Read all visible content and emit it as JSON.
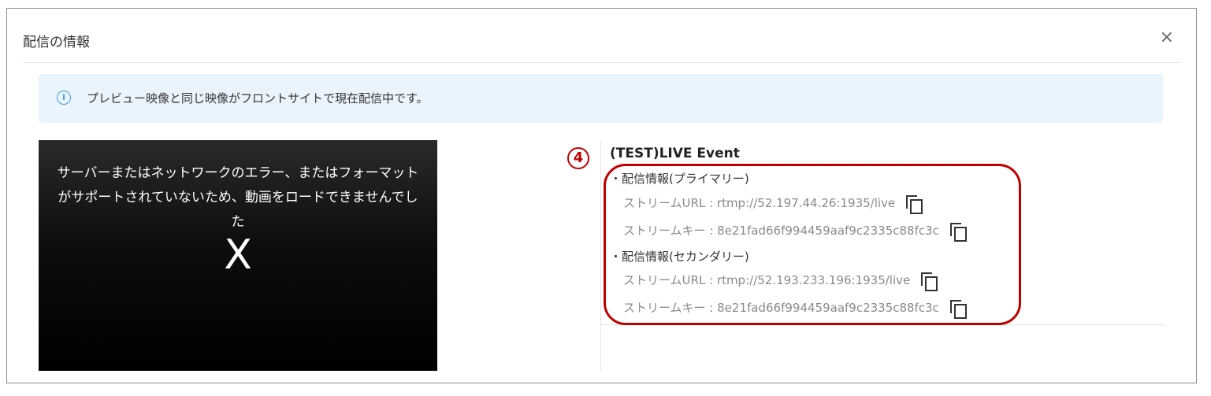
{
  "dialog": {
    "title": "配信の情報",
    "close_icon": "×"
  },
  "alert": {
    "icon": "i",
    "text": "プレビュー映像と同じ映像がフロントサイトで現在配信中です。"
  },
  "player": {
    "error_message": "サーバーまたはネットワークのエラー、またはフォーマットがサポートされていないため、動画をロードできませんでした",
    "error_icon": "X"
  },
  "event": {
    "marker": "4",
    "title": "(TEST)LIVE Event",
    "primary": {
      "label": "・配信情報(プライマリー)",
      "url_row": "ストリームURL : rtmp://52.197.44.26:1935/live",
      "key_row": "ストリームキー : 8e21fad66f994459aaf9c2335c88fc3c"
    },
    "secondary": {
      "label": "・配信情報(セカンダリー)",
      "url_row": "ストリームURL : rtmp://52.193.233.196:1935/live",
      "key_row": "ストリームキー : 8e21fad66f994459aaf9c2335c88fc3c"
    }
  },
  "colors": {
    "alert_bg": "#eaf4fc",
    "info_icon": "#3d9be0",
    "highlight": "#c00000"
  },
  "icons": [
    "close-icon",
    "info-icon",
    "copy-icon"
  ]
}
